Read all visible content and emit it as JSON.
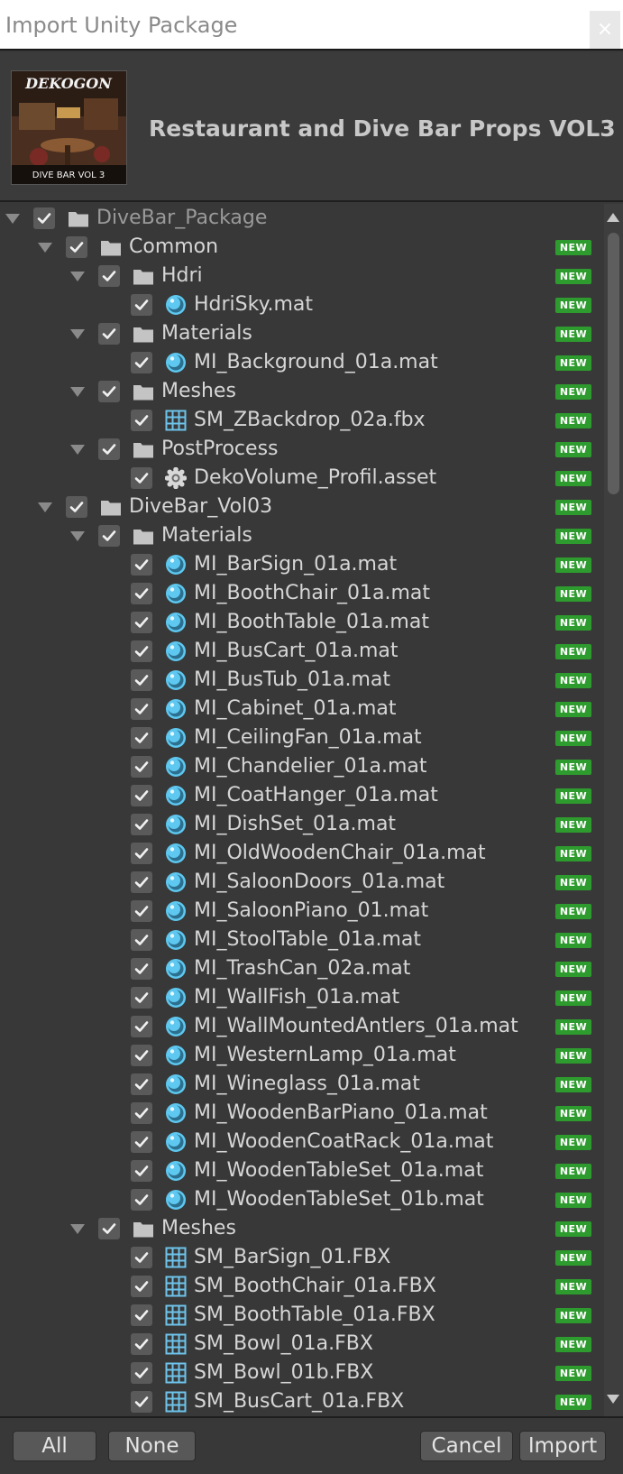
{
  "window": {
    "title": "Import Unity Package",
    "close_label": "×"
  },
  "package": {
    "name": "Restaurant and Dive Bar Props VOL3",
    "thumbnail_text_top": "DEKOGON",
    "thumbnail_text_bottom": "DIVE BAR VOL 3"
  },
  "badge_label": "NEW",
  "tree": [
    {
      "label": "DiveBar_Package",
      "level": 0,
      "icon": "folder-icon",
      "expanded": true,
      "checked": true,
      "badge": false,
      "dim": true
    },
    {
      "label": "Common",
      "level": 1,
      "icon": "folder-icon",
      "expanded": true,
      "checked": true,
      "badge": true
    },
    {
      "label": "Hdri",
      "level": 2,
      "icon": "folder-icon",
      "expanded": true,
      "checked": true,
      "badge": true
    },
    {
      "label": "HdriSky.mat",
      "level": 3,
      "icon": "material-icon",
      "checked": true,
      "badge": true
    },
    {
      "label": "Materials",
      "level": 2,
      "icon": "folder-icon",
      "expanded": true,
      "checked": true,
      "badge": true
    },
    {
      "label": "MI_Background_01a.mat",
      "level": 3,
      "icon": "material-icon",
      "checked": true,
      "badge": true
    },
    {
      "label": "Meshes",
      "level": 2,
      "icon": "folder-icon",
      "expanded": true,
      "checked": true,
      "badge": true
    },
    {
      "label": "SM_ZBackdrop_02a.fbx",
      "level": 3,
      "icon": "mesh-icon",
      "checked": true,
      "badge": true
    },
    {
      "label": "PostProcess",
      "level": 2,
      "icon": "folder-icon",
      "expanded": true,
      "checked": true,
      "badge": true
    },
    {
      "label": "DekoVolume_Profil.asset",
      "level": 3,
      "icon": "gear-icon",
      "checked": true,
      "badge": true
    },
    {
      "label": "DiveBar_Vol03",
      "level": 1,
      "icon": "folder-icon",
      "expanded": true,
      "checked": true,
      "badge": true
    },
    {
      "label": "Materials",
      "level": 2,
      "icon": "folder-icon",
      "expanded": true,
      "checked": true,
      "badge": true
    },
    {
      "label": "MI_BarSign_01a.mat",
      "level": 3,
      "icon": "material-icon",
      "checked": true,
      "badge": true
    },
    {
      "label": "MI_BoothChair_01a.mat",
      "level": 3,
      "icon": "material-icon",
      "checked": true,
      "badge": true
    },
    {
      "label": "MI_BoothTable_01a.mat",
      "level": 3,
      "icon": "material-icon",
      "checked": true,
      "badge": true
    },
    {
      "label": "MI_BusCart_01a.mat",
      "level": 3,
      "icon": "material-icon",
      "checked": true,
      "badge": true
    },
    {
      "label": "MI_BusTub_01a.mat",
      "level": 3,
      "icon": "material-icon",
      "checked": true,
      "badge": true
    },
    {
      "label": "MI_Cabinet_01a.mat",
      "level": 3,
      "icon": "material-icon",
      "checked": true,
      "badge": true
    },
    {
      "label": "MI_CeilingFan_01a.mat",
      "level": 3,
      "icon": "material-icon",
      "checked": true,
      "badge": true
    },
    {
      "label": "MI_Chandelier_01a.mat",
      "level": 3,
      "icon": "material-icon",
      "checked": true,
      "badge": true
    },
    {
      "label": "MI_CoatHanger_01a.mat",
      "level": 3,
      "icon": "material-icon",
      "checked": true,
      "badge": true
    },
    {
      "label": "MI_DishSet_01a.mat",
      "level": 3,
      "icon": "material-icon",
      "checked": true,
      "badge": true
    },
    {
      "label": "MI_OldWoodenChair_01a.mat",
      "level": 3,
      "icon": "material-icon",
      "checked": true,
      "badge": true
    },
    {
      "label": "MI_SaloonDoors_01a.mat",
      "level": 3,
      "icon": "material-icon",
      "checked": true,
      "badge": true
    },
    {
      "label": "MI_SaloonPiano_01.mat",
      "level": 3,
      "icon": "material-icon",
      "checked": true,
      "badge": true
    },
    {
      "label": "MI_StoolTable_01a.mat",
      "level": 3,
      "icon": "material-icon",
      "checked": true,
      "badge": true
    },
    {
      "label": "MI_TrashCan_02a.mat",
      "level": 3,
      "icon": "material-icon",
      "checked": true,
      "badge": true
    },
    {
      "label": "MI_WallFish_01a.mat",
      "level": 3,
      "icon": "material-icon",
      "checked": true,
      "badge": true
    },
    {
      "label": "MI_WallMountedAntlers_01a.mat",
      "level": 3,
      "icon": "material-icon",
      "checked": true,
      "badge": true
    },
    {
      "label": "MI_WesternLamp_01a.mat",
      "level": 3,
      "icon": "material-icon",
      "checked": true,
      "badge": true
    },
    {
      "label": "MI_Wineglass_01a.mat",
      "level": 3,
      "icon": "material-icon",
      "checked": true,
      "badge": true
    },
    {
      "label": "MI_WoodenBarPiano_01a.mat",
      "level": 3,
      "icon": "material-icon",
      "checked": true,
      "badge": true
    },
    {
      "label": "MI_WoodenCoatRack_01a.mat",
      "level": 3,
      "icon": "material-icon",
      "checked": true,
      "badge": true
    },
    {
      "label": "MI_WoodenTableSet_01a.mat",
      "level": 3,
      "icon": "material-icon",
      "checked": true,
      "badge": true
    },
    {
      "label": "MI_WoodenTableSet_01b.mat",
      "level": 3,
      "icon": "material-icon",
      "checked": true,
      "badge": true
    },
    {
      "label": "Meshes",
      "level": 2,
      "icon": "folder-icon",
      "expanded": true,
      "checked": true,
      "badge": true
    },
    {
      "label": "SM_BarSign_01.FBX",
      "level": 3,
      "icon": "mesh-icon",
      "checked": true,
      "badge": true
    },
    {
      "label": "SM_BoothChair_01a.FBX",
      "level": 3,
      "icon": "mesh-icon",
      "checked": true,
      "badge": true
    },
    {
      "label": "SM_BoothTable_01a.FBX",
      "level": 3,
      "icon": "mesh-icon",
      "checked": true,
      "badge": true
    },
    {
      "label": "SM_Bowl_01a.FBX",
      "level": 3,
      "icon": "mesh-icon",
      "checked": true,
      "badge": true
    },
    {
      "label": "SM_Bowl_01b.FBX",
      "level": 3,
      "icon": "mesh-icon",
      "checked": true,
      "badge": true
    },
    {
      "label": "SM_BusCart_01a.FBX",
      "level": 3,
      "icon": "mesh-icon",
      "checked": true,
      "badge": true
    }
  ],
  "footer": {
    "all_label": "All",
    "none_label": "None",
    "cancel_label": "Cancel",
    "import_label": "Import"
  },
  "colors": {
    "badge_green": "#2e9b2e",
    "material_blue": "#5ec8f0",
    "mesh_blue": "#6ec3ea"
  }
}
